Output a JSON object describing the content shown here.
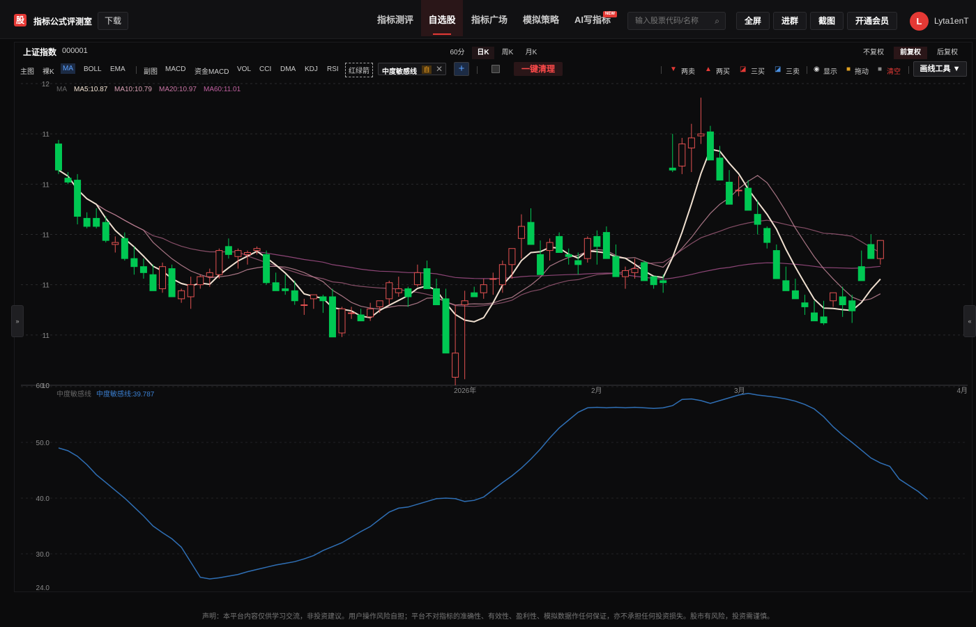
{
  "topbar": {
    "logo_text": "股",
    "brand": "指标公式评测室",
    "download": "下载",
    "nav": [
      "指标测评",
      "自选股",
      "指标广场",
      "模拟策略",
      "AI写指标"
    ],
    "nav_active_index": 1,
    "new_badge": "NEW",
    "search_placeholder": "输入股票代码/名称",
    "buttons": [
      "全屏",
      "进群",
      "截图",
      "开通会员"
    ],
    "avatar_letter": "L",
    "username": "Lyta1enT"
  },
  "stock": {
    "name": "上证指数",
    "code": "000001"
  },
  "timeframes": [
    "60分",
    "日K",
    "周K",
    "月K"
  ],
  "timeframe_active_index": 1,
  "adjust": [
    "不复权",
    "前复权",
    "后复权"
  ],
  "adjust_active_index": 1,
  "toolbar": {
    "left": [
      "主图",
      "裸K",
      "MA",
      "BOLL",
      "EMA"
    ],
    "left_active_index": 2,
    "sub": [
      "副图",
      "MACD",
      "资金MACD",
      "VOL",
      "CCI",
      "DMA",
      "KDJ",
      "RSI"
    ],
    "red_green_arrow": "红绿箭",
    "custom_indicator": "中度敏感线",
    "custom_tag": "自",
    "clear_all": "一键清理",
    "right": [
      "两卖",
      "两买",
      "三买",
      "三卖",
      "显示",
      "拖动",
      "清空"
    ],
    "draw_tools": "画线工具 ▼"
  },
  "colors": {
    "up": "#e45252",
    "down": "#00c853",
    "ma5": "#f0e0d0",
    "ma10": "#c4889a",
    "ma20": "#9c5a78",
    "ma60": "#a4508a",
    "sub_line": "#2f6fb5",
    "accent": "#e53935"
  },
  "legend": {
    "ma_title": "MA",
    "ma5": "MA5:10.87",
    "ma10": "MA10:10.79",
    "ma20": "MA20:10.97",
    "ma60": "MA60:11.01"
  },
  "sub_legend": {
    "title": "中度敏感线",
    "value": "中度敏感线:39.787"
  },
  "main_axis_labels": [
    "12",
    "11",
    "11",
    "11",
    "11",
    "11",
    "10"
  ],
  "sub_axis_labels": [
    "60.0",
    "50.0",
    "40.0",
    "30.0",
    "24.0"
  ],
  "x_labels": [
    "2026年",
    "2月",
    "3月",
    "4月"
  ],
  "side_tabs": [
    "»",
    "«"
  ],
  "disclaimer": "声明：本平台内容仅供学习交流，非投资建议。用户操作风险自担；平台不对指标的准确性、有效性、盈利性、模拟数据作任何保证，亦不承担任何投资损失。股市有风险，投资需谨慎。",
  "chart_data": [
    {
      "type": "candlestick",
      "title": "上证指数 000001",
      "ylabel": "",
      "ylim": [
        10.5,
        12.0
      ],
      "x_labels": [
        "2026年",
        "2月",
        "3月",
        "4月"
      ],
      "ohlc": [
        [
          11.7,
          11.72,
          11.55,
          11.57
        ],
        [
          11.53,
          11.56,
          11.5,
          11.51
        ],
        [
          11.52,
          11.55,
          11.3,
          11.34
        ],
        [
          11.33,
          11.36,
          11.28,
          11.29
        ],
        [
          11.33,
          11.38,
          11.28,
          11.29
        ],
        [
          11.31,
          11.34,
          11.21,
          11.22
        ],
        [
          11.2,
          11.24,
          11.16,
          11.21
        ],
        [
          11.23,
          11.26,
          11.12,
          11.13
        ],
        [
          11.13,
          11.19,
          11.05,
          11.09
        ],
        [
          11.09,
          11.13,
          11.03,
          11.06
        ],
        [
          11.05,
          11.1,
          10.98,
          10.97
        ],
        [
          10.98,
          11.11,
          10.96,
          11.09
        ],
        [
          11.08,
          11.1,
          10.94,
          10.94
        ],
        [
          10.93,
          10.98,
          10.91,
          10.97
        ],
        [
          10.94,
          11.04,
          10.88,
          11.0
        ],
        [
          11.0,
          11.05,
          10.98,
          11.04
        ],
        [
          11.04,
          11.08,
          10.99,
          11.06
        ],
        [
          11.05,
          11.18,
          11.03,
          11.17
        ],
        [
          11.19,
          11.23,
          11.13,
          11.15
        ],
        [
          11.14,
          11.18,
          11.08,
          11.17
        ],
        [
          11.15,
          11.17,
          11.1,
          11.16
        ],
        [
          11.17,
          11.19,
          11.15,
          11.18
        ],
        [
          11.15,
          11.17,
          11.0,
          11.01
        ],
        [
          11.01,
          11.06,
          10.98,
          10.97
        ],
        [
          10.98,
          11.05,
          10.95,
          10.97
        ],
        [
          10.97,
          11.02,
          10.9,
          10.92
        ],
        [
          10.9,
          10.93,
          10.85,
          10.9
        ],
        [
          10.93,
          10.95,
          10.88,
          10.95
        ],
        [
          10.94,
          10.95,
          10.86,
          10.92
        ],
        [
          10.94,
          10.98,
          10.78,
          10.74
        ],
        [
          10.76,
          10.89,
          10.74,
          10.88
        ],
        [
          10.86,
          10.89,
          10.83,
          10.86
        ],
        [
          10.85,
          10.88,
          10.82,
          10.82
        ],
        [
          10.84,
          10.91,
          10.82,
          10.88
        ],
        [
          10.89,
          10.92,
          10.86,
          10.92
        ],
        [
          10.93,
          11.02,
          10.9,
          11.01
        ],
        [
          10.96,
          11.04,
          10.94,
          10.98
        ],
        [
          10.98,
          10.99,
          10.89,
          10.94
        ],
        [
          11.0,
          11.1,
          10.99,
          11.06
        ],
        [
          11.08,
          11.12,
          10.99,
          10.98
        ],
        [
          10.98,
          11.03,
          10.92,
          10.9
        ],
        [
          10.93,
          10.98,
          10.9,
          10.66
        ],
        [
          10.54,
          10.9,
          10.5,
          10.66
        ],
        [
          10.9,
          10.97,
          10.53,
          10.92
        ],
        [
          10.96,
          10.99,
          10.94,
          10.94
        ],
        [
          10.96,
          11.03,
          10.93,
          11.0
        ],
        [
          11.03,
          11.06,
          10.95,
          11.03
        ],
        [
          11.0,
          11.12,
          10.96,
          11.1
        ],
        [
          11.1,
          11.15,
          11.03,
          11.18
        ],
        [
          11.23,
          11.35,
          11.13,
          11.29
        ],
        [
          11.31,
          11.38,
          11.24,
          11.2
        ],
        [
          11.15,
          11.22,
          11.06,
          11.05
        ],
        [
          11.17,
          11.23,
          11.12,
          11.21
        ],
        [
          11.24,
          11.26,
          11.18,
          11.16
        ],
        [
          11.15,
          11.18,
          11.1,
          11.14
        ],
        [
          11.12,
          11.16,
          11.05,
          11.1
        ],
        [
          11.13,
          11.24,
          11.11,
          11.23
        ],
        [
          11.24,
          11.27,
          11.1,
          11.19
        ],
        [
          11.26,
          11.29,
          11.18,
          11.13
        ],
        [
          11.14,
          11.2,
          11.04,
          11.04
        ],
        [
          11.04,
          11.09,
          10.98,
          11.07
        ],
        [
          11.06,
          11.13,
          11.03,
          11.08
        ],
        [
          11.11,
          11.12,
          11.04,
          11.02
        ],
        [
          11.04,
          11.04,
          10.98,
          11.0
        ],
        [
          11.02,
          11.05,
          10.96,
          11.01
        ],
        [
          11.58,
          11.75,
          11.56,
          11.57
        ],
        [
          11.59,
          11.73,
          11.55,
          11.7
        ],
        [
          11.68,
          11.8,
          11.56,
          11.73
        ],
        [
          11.74,
          11.93,
          11.7,
          11.75
        ],
        [
          11.76,
          11.79,
          11.66,
          11.62
        ],
        [
          11.63,
          11.69,
          11.53,
          11.52
        ],
        [
          11.51,
          11.57,
          11.4,
          11.4
        ],
        [
          11.47,
          11.54,
          11.44,
          11.47
        ],
        [
          11.48,
          11.52,
          11.39,
          11.37
        ],
        [
          11.35,
          11.42,
          11.25,
          11.3
        ],
        [
          11.28,
          11.29,
          11.18,
          11.21
        ],
        [
          11.17,
          11.2,
          11.05,
          11.03
        ],
        [
          11.02,
          11.09,
          10.97,
          10.97
        ],
        [
          10.97,
          11.03,
          10.93,
          10.93
        ],
        [
          10.91,
          10.95,
          10.85,
          10.89
        ],
        [
          10.86,
          10.92,
          10.82,
          10.82
        ],
        [
          10.84,
          10.92,
          10.8,
          10.81
        ],
        [
          10.92,
          10.95,
          10.89,
          10.96
        ],
        [
          10.94,
          10.99,
          10.84,
          10.9
        ],
        [
          10.92,
          10.95,
          10.81,
          10.87
        ],
        [
          11.09,
          11.17,
          11.05,
          11.02
        ],
        [
          11.2,
          11.25,
          11.18,
          11.13
        ],
        [
          11.13,
          11.2,
          11.1,
          11.22
        ]
      ]
    },
    {
      "type": "line",
      "title": "中度敏感线",
      "ylim": [
        24,
        60
      ],
      "values": [
        49.0,
        48.5,
        47.5,
        46.0,
        44.2,
        42.8,
        41.4,
        40.0,
        38.4,
        36.8,
        35.0,
        33.8,
        32.7,
        31.2,
        28.5,
        25.8,
        25.5,
        25.7,
        26.0,
        26.3,
        26.8,
        27.2,
        27.6,
        28.0,
        28.3,
        28.6,
        29.1,
        29.7,
        30.6,
        31.3,
        32.0,
        33.0,
        34.0,
        34.9,
        36.2,
        37.5,
        38.2,
        38.4,
        38.9,
        39.4,
        39.9,
        40.0,
        39.9,
        39.4,
        39.6,
        40.2,
        41.5,
        42.8,
        44.0,
        45.4,
        47.0,
        48.8,
        50.8,
        52.6,
        54.0,
        55.4,
        56.2,
        56.3,
        56.2,
        56.3,
        56.2,
        56.3,
        56.2,
        56.1,
        56.2,
        56.6,
        57.7,
        57.8,
        57.5,
        57.0,
        57.5,
        58.0,
        58.5,
        58.8,
        58.5,
        58.3,
        58.1,
        57.8,
        57.4,
        56.8,
        56.0,
        54.6,
        52.8,
        51.3,
        50.0,
        48.6,
        47.2,
        46.3,
        45.7,
        43.4,
        42.3,
        41.2,
        39.8
      ]
    }
  ]
}
